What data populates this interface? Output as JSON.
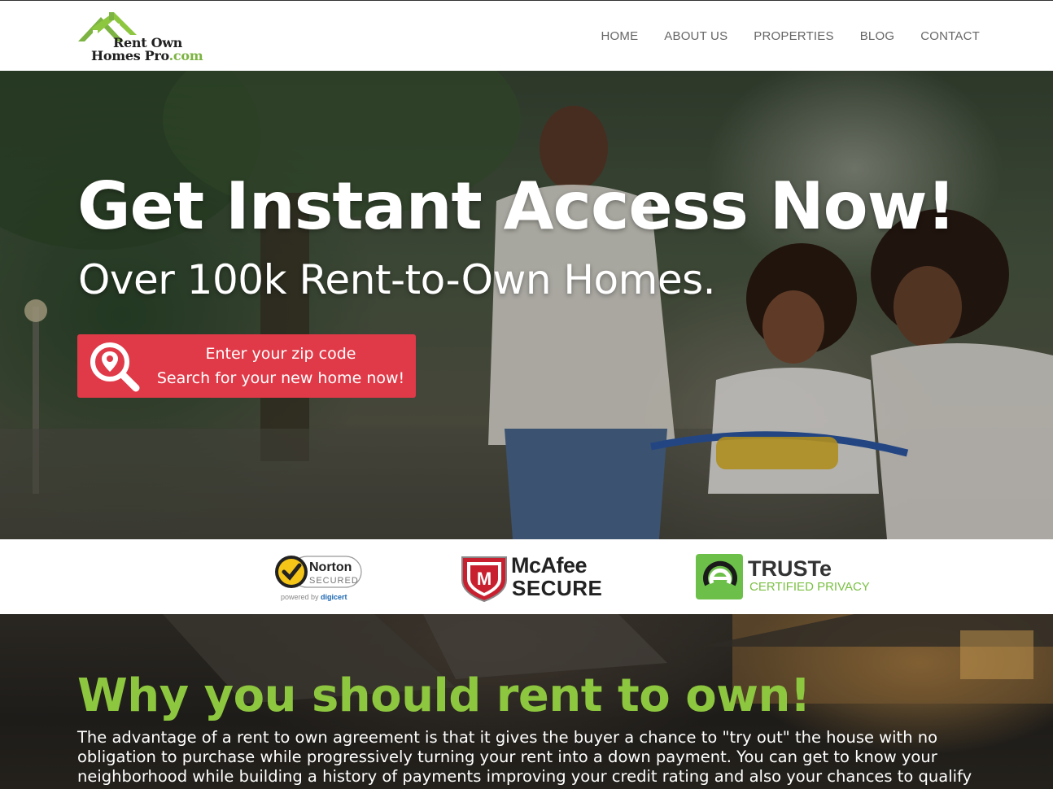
{
  "brand": {
    "line1": "Rent Own",
    "line2": "Homes Pro",
    "line2_suffix": ".com",
    "accent_color": "#7cb342"
  },
  "nav": {
    "items": [
      {
        "label": "HOME"
      },
      {
        "label": "ABOUT US"
      },
      {
        "label": "PROPERTIES"
      },
      {
        "label": "BLOG"
      },
      {
        "label": "CONTACT"
      }
    ]
  },
  "hero": {
    "title": "Get Instant Access Now!",
    "subtitle": "Over 100k Rent-to-Own Homes.",
    "search_button": {
      "line1": "Enter your zip code",
      "line2": "Search for your new home now!",
      "icon": "location-search-icon",
      "color": "#e03a48"
    }
  },
  "badges": {
    "norton": {
      "name": "Norton",
      "sub": "SECURED",
      "powered": "powered by",
      "powered_brand": "digicert"
    },
    "mcafee": {
      "name": "McAfee",
      "sub": "SECURE"
    },
    "truste": {
      "name": "TRUSTe",
      "sub": "CERTIFIED PRIVACY"
    }
  },
  "why": {
    "title": "Why you should rent to own!",
    "title_color": "#8dc63f",
    "body": "The advantage of a rent to own agreement is that it gives the buyer a chance to \"try out\" the house with no obligation to purchase while progressively turning your rent into a down payment. You can get to know your neighborhood while building a history of payments improving your credit rating and also your chances to qualify for a conventional"
  }
}
